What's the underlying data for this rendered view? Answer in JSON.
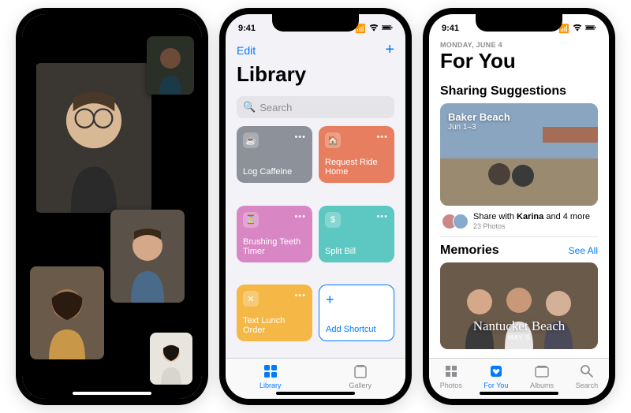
{
  "status": {
    "time": "9:41"
  },
  "shortcuts": {
    "edit": "Edit",
    "title": "Library",
    "search_placeholder": "Search",
    "tiles": [
      {
        "label": "Log Caffeine",
        "icon": "☕",
        "color": "#8d9199"
      },
      {
        "label": "Request Ride Home",
        "icon": "🏠",
        "color": "#e67e5f"
      },
      {
        "label": "Brushing Teeth Timer",
        "icon": "⏳",
        "color": "#d986c5"
      },
      {
        "label": "Split Bill",
        "icon": "$",
        "color": "#5dc7c1"
      },
      {
        "label": "Text Lunch Order",
        "icon": "✕",
        "color": "#f5b847"
      }
    ],
    "add_label": "Add Shortcut",
    "tabs": {
      "library": "Library",
      "gallery": "Gallery"
    }
  },
  "photos": {
    "date_label": "MONDAY, JUNE 4",
    "title": "For You",
    "sharing_title": "Sharing Suggestions",
    "share_card": {
      "location": "Baker Beach",
      "dates": "Jun 1–3"
    },
    "share_row": {
      "text_1": "Share with ",
      "bold": "Karina",
      "text_2": " and 4 more",
      "sub": "23 Photos"
    },
    "memories_title": "Memories",
    "see_all": "See All",
    "memory_card": {
      "title": "Nantucket Beach",
      "sub": "MAY 5"
    },
    "tabs": {
      "photos": "Photos",
      "foryou": "For You",
      "albums": "Albums",
      "search": "Search"
    }
  },
  "colors": {
    "ios_blue": "#007aff"
  }
}
